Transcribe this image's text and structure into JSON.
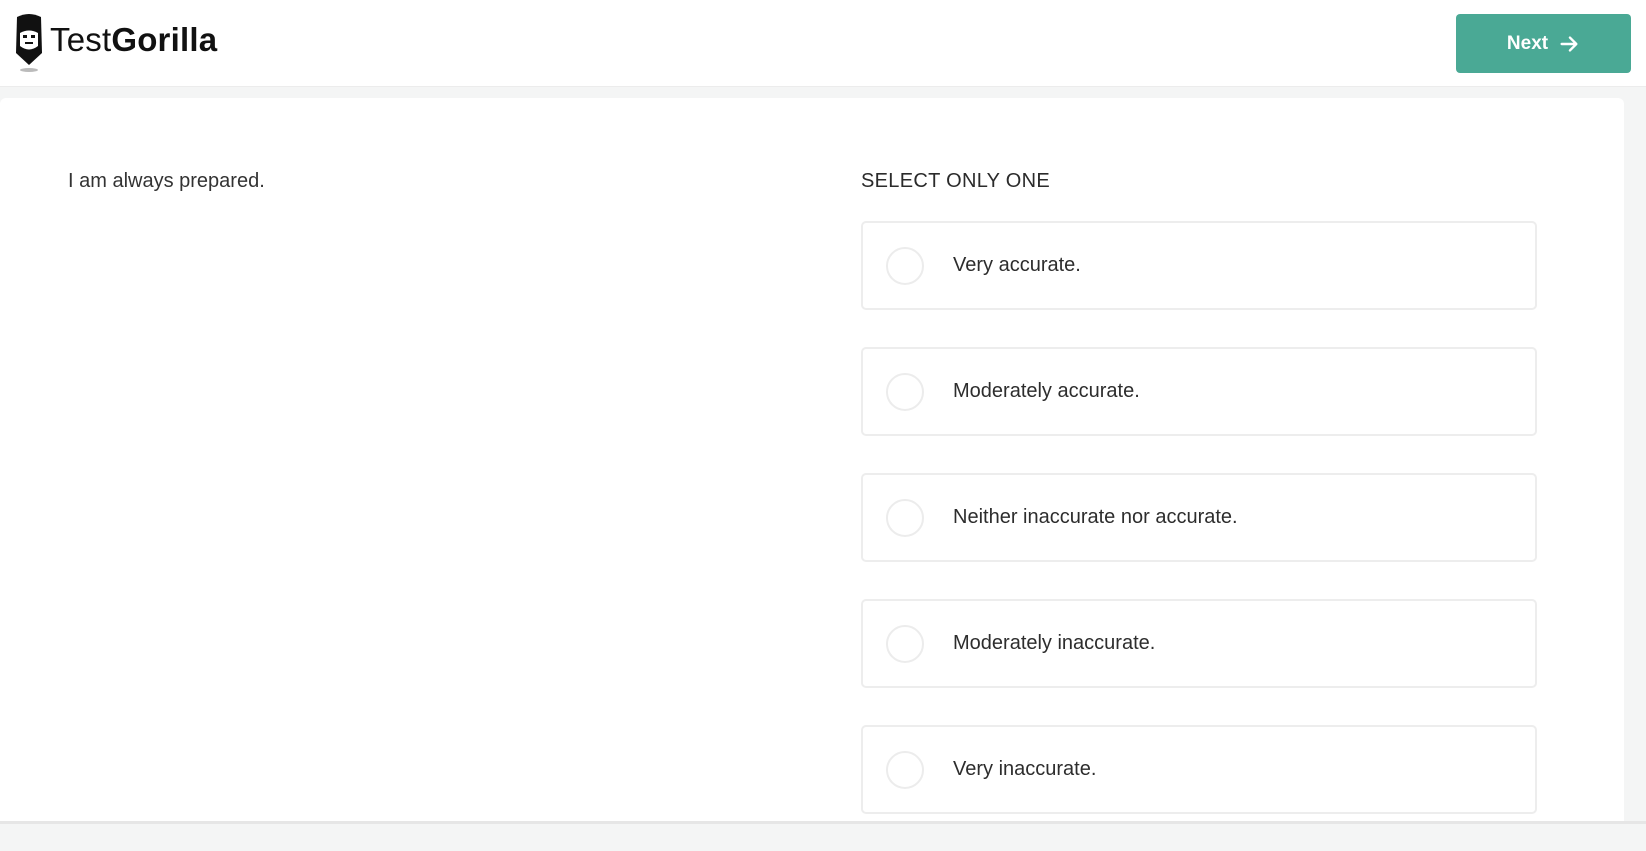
{
  "header": {
    "logo": {
      "light": "Test",
      "bold": "Gorilla"
    },
    "next_button": {
      "label": "Next",
      "icon": "arrow-right-icon"
    }
  },
  "question": {
    "text": "I am always prepared.",
    "instruction": "SELECT ONLY ONE",
    "options": [
      {
        "label": "Very accurate.",
        "selected": false
      },
      {
        "label": "Moderately accurate.",
        "selected": false
      },
      {
        "label": "Neither inaccurate nor accurate.",
        "selected": false
      },
      {
        "label": "Moderately inaccurate.",
        "selected": false
      },
      {
        "label": "Very inaccurate.",
        "selected": false
      }
    ]
  },
  "colors": {
    "accent": "#4aa995"
  }
}
